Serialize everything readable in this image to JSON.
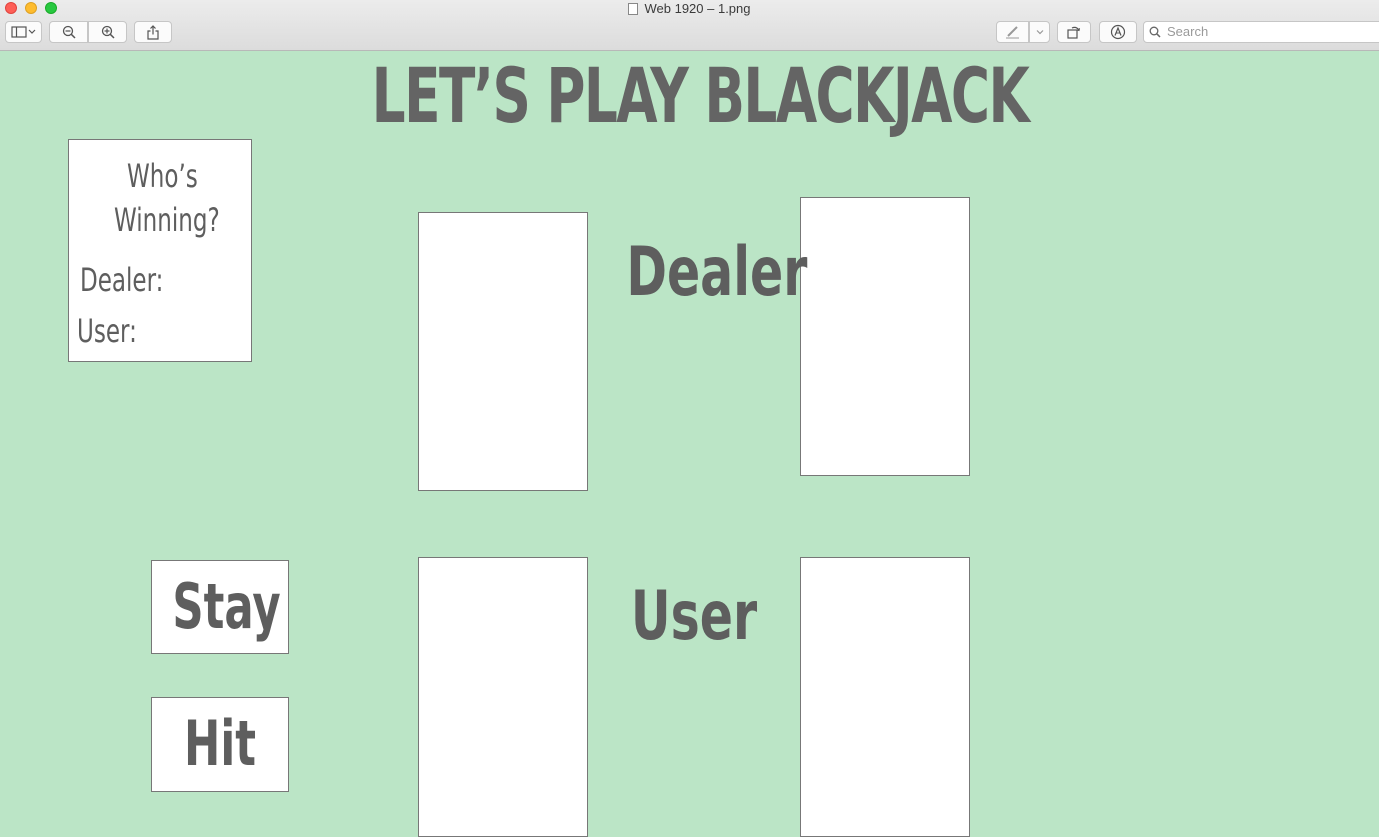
{
  "window": {
    "title": "Web 1920 – 1.png",
    "search_placeholder": "Search"
  },
  "toolbar": {
    "icons": [
      "sidebar-icon",
      "chevron-down-icon",
      "zoom-out-icon",
      "zoom-in-icon",
      "share-icon",
      "markup-pen-icon",
      "chevron-down-icon",
      "rotate-icon",
      "annotate-icon",
      "search-icon"
    ]
  },
  "page": {
    "heading": "LET’S PLAY BLACKJACK",
    "score_panel": {
      "title_line1": "Who’s",
      "title_line2": "Winning?",
      "dealer_label": "Dealer:",
      "user_label": "User:"
    },
    "dealer_label": "Dealer",
    "user_label": "User",
    "stay_button": "Stay",
    "hit_button": "Hit"
  },
  "colors": {
    "background": "#bbe5c6",
    "text": "#646464",
    "card": "#ffffff"
  }
}
